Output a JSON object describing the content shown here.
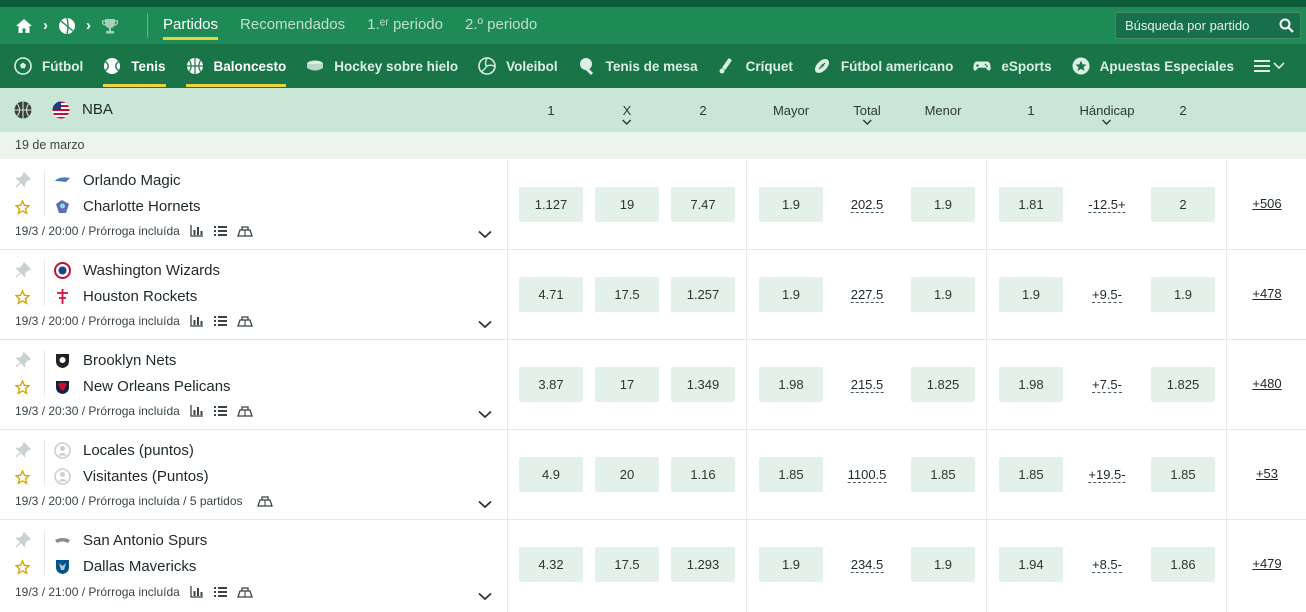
{
  "topnav": {
    "tabs": [
      {
        "label": "Partidos",
        "active": true
      },
      {
        "label": "Recomendados",
        "active": false
      },
      {
        "label": "1.ᵉʳ periodo",
        "active": false
      },
      {
        "label": "2.º periodo",
        "active": false
      }
    ],
    "search_placeholder": "Búsqueda por partido"
  },
  "sports": [
    {
      "label": "Fútbol",
      "icon": "soccer-ball-icon",
      "active": false
    },
    {
      "label": "Tenis",
      "icon": "tennis-ball-icon",
      "active": true
    },
    {
      "label": "Baloncesto",
      "icon": "basketball-icon",
      "active": true
    },
    {
      "label": "Hockey sobre hielo",
      "icon": "hockey-puck-icon",
      "active": false
    },
    {
      "label": "Voleibol",
      "icon": "volleyball-icon",
      "active": false
    },
    {
      "label": "Tenis de mesa",
      "icon": "table-tennis-icon",
      "active": false
    },
    {
      "label": "Críquet",
      "icon": "cricket-icon",
      "active": false
    },
    {
      "label": "Fútbol americano",
      "icon": "american-football-icon",
      "active": false
    },
    {
      "label": "eSports",
      "icon": "gamepad-icon",
      "active": false
    },
    {
      "label": "Apuestas Especiales",
      "icon": "special-star-icon",
      "active": false
    }
  ],
  "league": {
    "name": "NBA",
    "columns": [
      "1",
      "X",
      "2",
      "Mayor",
      "Total",
      "Menor",
      "1",
      "Hándicap",
      "2"
    ]
  },
  "date": "19 de marzo",
  "matches": [
    {
      "home": "Orlando Magic",
      "away": "Charlotte Hornets",
      "time": "19/3",
      "hour": "20:00",
      "note": "Prórroga incluída",
      "extra": "",
      "odd1": "1.127",
      "oddx": "19",
      "odd2": "7.47",
      "over": "1.9",
      "total": "202.5",
      "under": "1.9",
      "h1": "1.81",
      "handicap": "-12.5+",
      "h2": "2",
      "more": "+506"
    },
    {
      "home": "Washington Wizards",
      "away": "Houston Rockets",
      "time": "19/3",
      "hour": "20:00",
      "note": "Prórroga incluída",
      "extra": "",
      "odd1": "4.71",
      "oddx": "17.5",
      "odd2": "1.257",
      "over": "1.9",
      "total": "227.5",
      "under": "1.9",
      "h1": "1.9",
      "handicap": "+9.5-",
      "h2": "1.9",
      "more": "+478"
    },
    {
      "home": "Brooklyn Nets",
      "away": "New Orleans Pelicans",
      "time": "19/3",
      "hour": "20:30",
      "note": "Prórroga incluída",
      "extra": "",
      "odd1": "3.87",
      "oddx": "17",
      "odd2": "1.349",
      "over": "1.98",
      "total": "215.5",
      "under": "1.825",
      "h1": "1.98",
      "handicap": "+7.5-",
      "h2": "1.825",
      "more": "+480"
    },
    {
      "home": "Locales (puntos)",
      "away": "Visitantes (Puntos)",
      "time": "19/3",
      "hour": "20:00",
      "note": "Prórroga incluída",
      "extra": "5 partidos",
      "odd1": "4.9",
      "oddx": "20",
      "odd2": "1.16",
      "over": "1.85",
      "total": "1100.5",
      "under": "1.85",
      "h1": "1.85",
      "handicap": "+19.5-",
      "h2": "1.85",
      "more": "+53"
    },
    {
      "home": "San Antonio Spurs",
      "away": "Dallas Mavericks",
      "time": "19/3",
      "hour": "21:00",
      "note": "Prórroga incluída",
      "extra": "",
      "odd1": "4.32",
      "oddx": "17.5",
      "odd2": "1.293",
      "over": "1.9",
      "total": "234.5",
      "under": "1.9",
      "h1": "1.94",
      "handicap": "+8.5-",
      "h2": "1.86",
      "more": "+479"
    }
  ],
  "colors": {
    "topbar": "#1e8a55",
    "sportsbar": "#197548",
    "accent": "#e8d33a",
    "league": "#c9e6d6",
    "odd_bg": "#e4f1ea"
  }
}
